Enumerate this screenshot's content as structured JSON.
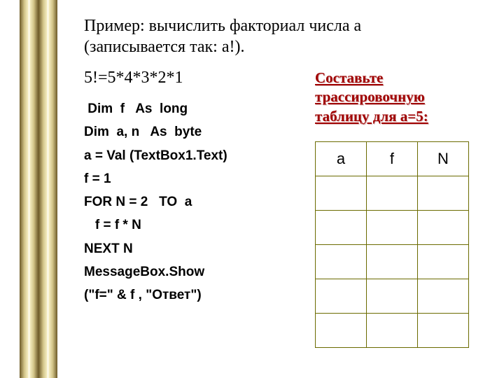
{
  "title_line1": "Пример: вычислить факториал числа а",
  "title_line2": "(записывается так: а!).",
  "fact_example": "5!=5*4*3*2*1",
  "code_lines": [
    " Dim  f   As  long",
    "Dim  a, n   As  byte",
    "a = Val (TextBox1.Text)",
    "f = 1",
    "FOR N = 2   TO  a",
    "   f = f * N",
    "NEXT N",
    "MessageBox.Show",
    "(\"f=\" & f , \"Ответ\")"
  ],
  "task_line1": "Составьте",
  "task_line2": "трассировочную",
  "task_line3": "таблицу для  а=5:",
  "table": {
    "headers": [
      "a",
      "f",
      "N"
    ],
    "rows": [
      [
        "",
        "",
        ""
      ],
      [
        "",
        "",
        ""
      ],
      [
        "",
        "",
        ""
      ],
      [
        "",
        "",
        ""
      ],
      [
        "",
        "",
        ""
      ]
    ]
  },
  "chart_data": {
    "type": "table",
    "title": "Trace table for a=5 (empty)",
    "columns": [
      "a",
      "f",
      "N"
    ],
    "rows": []
  }
}
